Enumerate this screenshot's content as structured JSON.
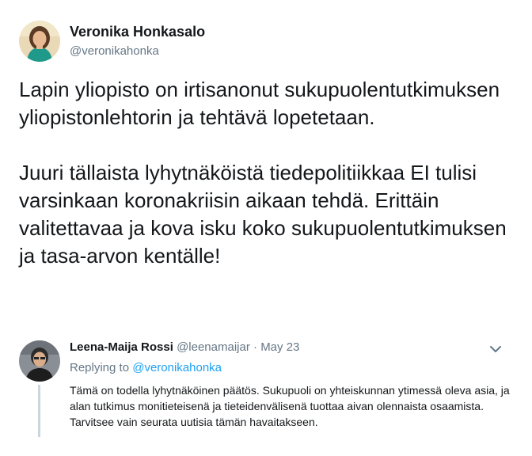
{
  "tweet": {
    "author": {
      "display_name": "Veronika Honkasalo",
      "handle": "@veronikahonka",
      "avatar_icon": "profile-photo"
    },
    "text": "Lapin yliopisto on irtisanonut sukupuolentutkimuksen yliopistonlehtorin ja tehtävä lopetetaan.\n\nJuuri tällaista lyhytnäköistä tiedepolitiikkaa EI tulisi varsinkaan koronakriisin aikaan tehdä. Erittäin valitettavaa ja kova isku koko sukupuolentutkimuksen ja tasa-arvon kentälle!"
  },
  "reply": {
    "author": {
      "display_name": "Leena-Maija Rossi",
      "handle": "@leenamaijar",
      "separator": "·",
      "date": "May 23",
      "avatar_icon": "profile-photo"
    },
    "replying_to_label": "Replying to",
    "replying_to_handle": "@veronikahonka",
    "text": "Tämä on todella lyhytnäköinen päätös. Sukupuoli on yhteiskunnan ytimessä oleva asia, ja alan tutkimus monitieteisenä ja tieteidenvälisenä tuottaa aivan olennaista osaamista. Tarvitsee vain seurata uutisia tämän havaitakseen.",
    "menu_icon": "chevron-down-icon"
  },
  "colors": {
    "primary_text": "#14171a",
    "secondary_text": "#657786",
    "link": "#1da1f2",
    "thread_line": "#ccd6dd"
  }
}
